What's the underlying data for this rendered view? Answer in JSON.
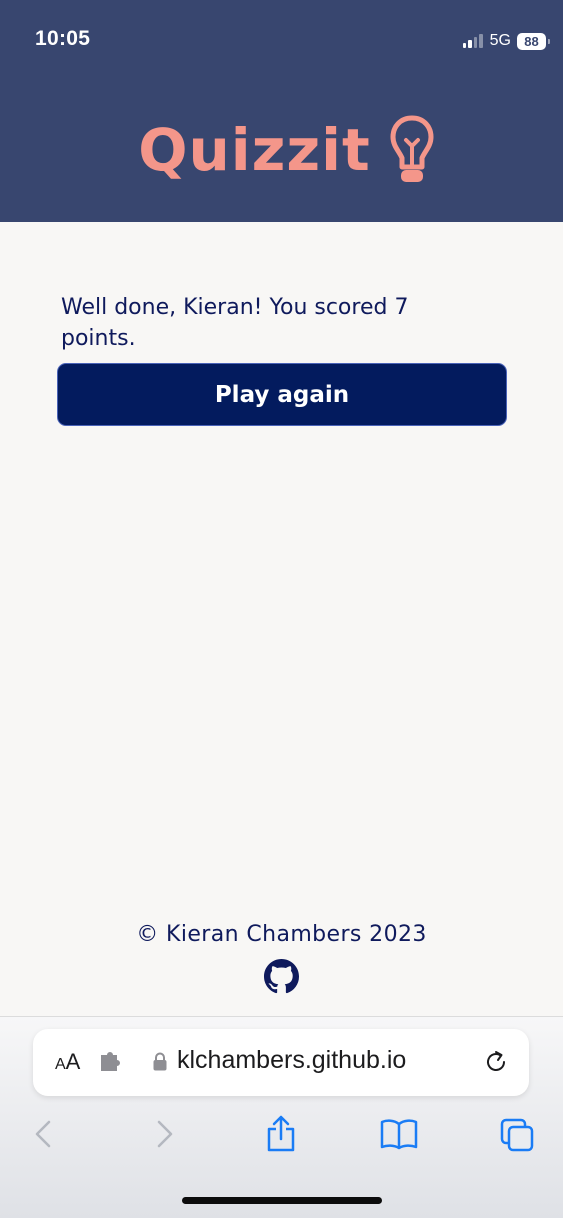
{
  "status_bar": {
    "time": "10:05",
    "network": "5G",
    "battery": "88"
  },
  "header": {
    "logo_text": "Quizzit",
    "logo_icon": "lightbulb-icon"
  },
  "main": {
    "result_message": "Well done, Kieran! You scored 7 points.",
    "play_again_label": "Play again"
  },
  "footer": {
    "copyright": "© Kieran Chambers 2023",
    "icon": "github-icon"
  },
  "browser": {
    "text_size_label_small": "A",
    "text_size_label_big": "A",
    "url": "klchambers.github.io"
  },
  "colors": {
    "header_bg": "#38466f",
    "logo": "#f4968a",
    "button_bg": "#031b5e",
    "text": "#0f1a5c",
    "page_bg": "#f8f7f5",
    "ios_blue": "#1a7cf5"
  }
}
